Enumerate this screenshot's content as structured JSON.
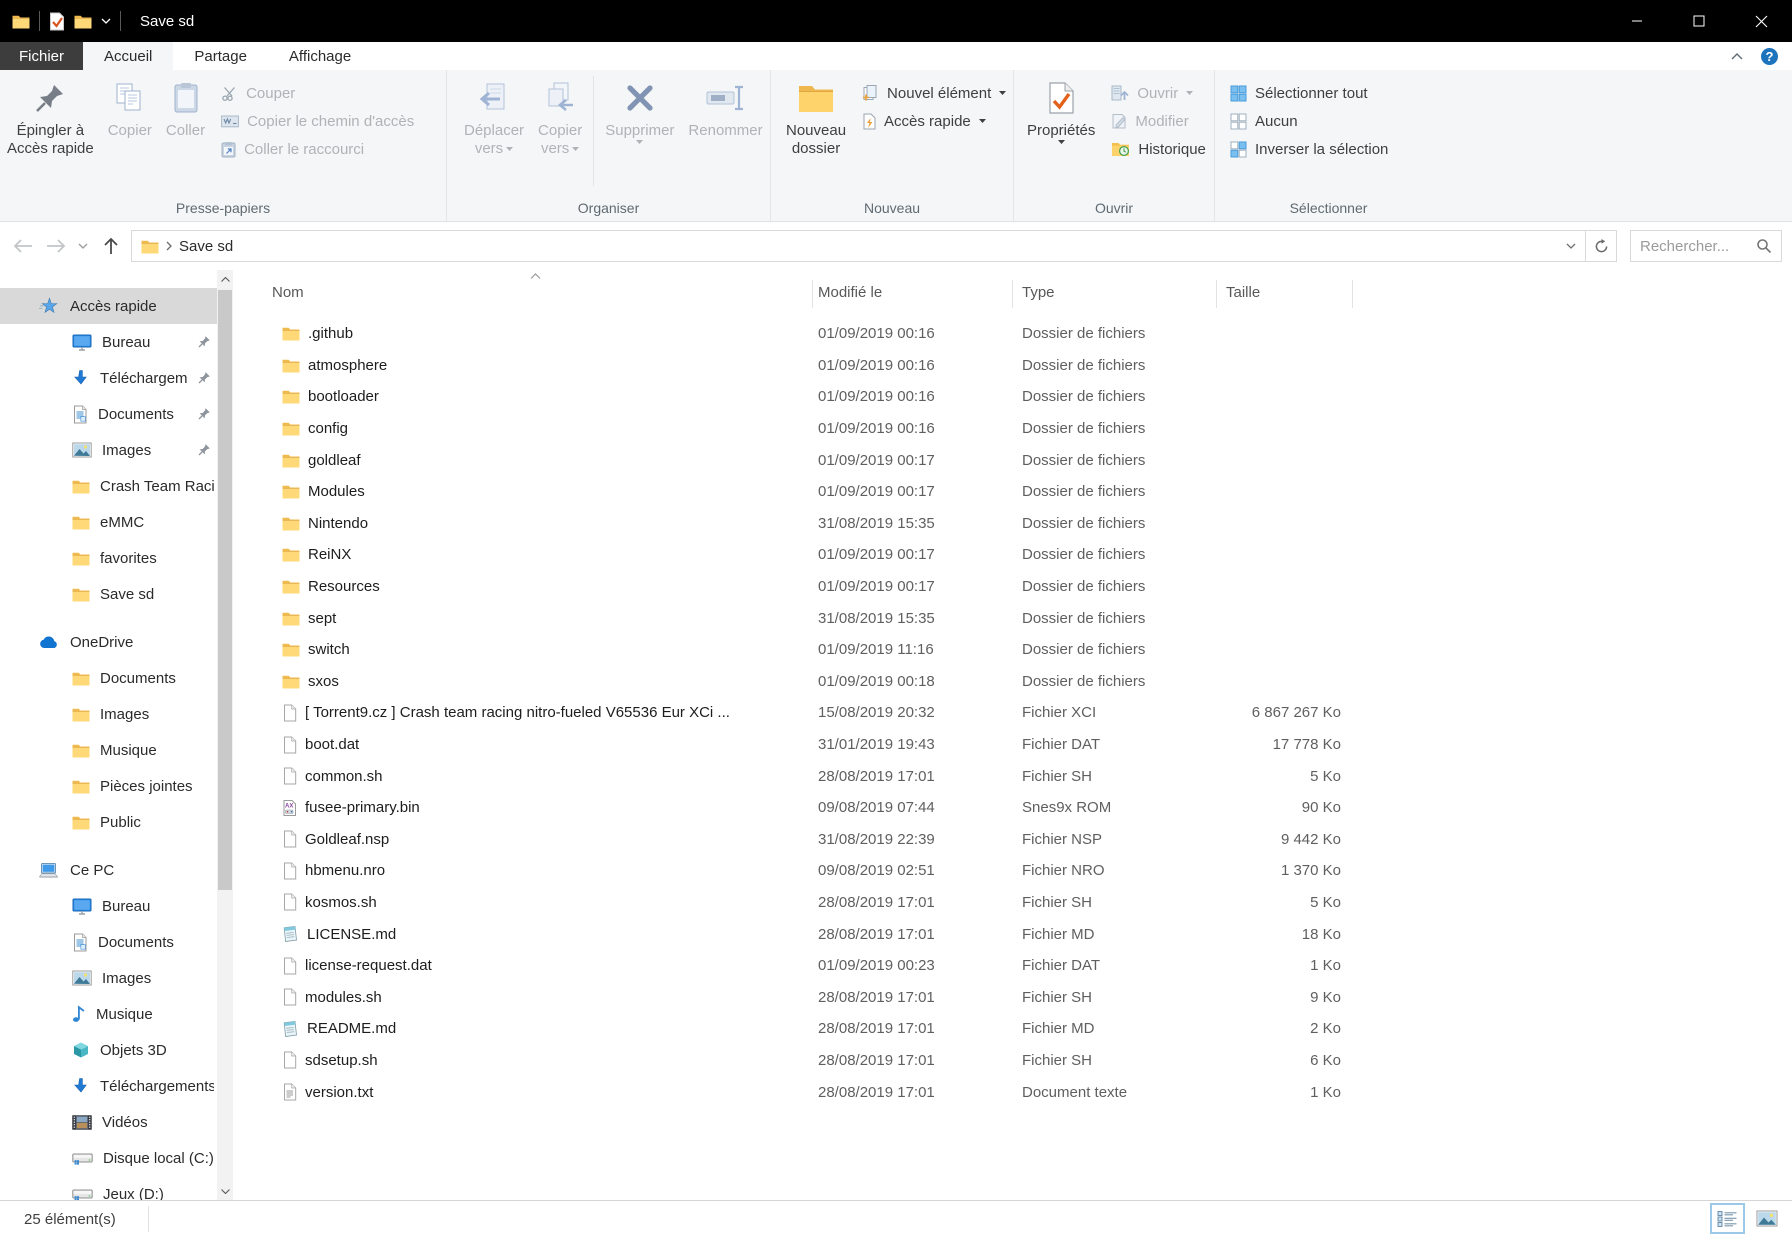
{
  "titlebar": {
    "title": "Save sd"
  },
  "tabs": {
    "file": "Fichier",
    "home": "Accueil",
    "share": "Partage",
    "view": "Affichage"
  },
  "ribbon": {
    "clipboard": {
      "group_label": "Presse-papiers",
      "pin_line1": "Épingler à",
      "pin_line2": "Accès rapide",
      "copy": "Copier",
      "paste": "Coller",
      "cut": "Couper",
      "copy_path": "Copier le chemin d'accès",
      "paste_shortcut": "Coller le raccourci"
    },
    "organize": {
      "group_label": "Organiser",
      "move_line1": "Déplacer",
      "move_line2": "vers",
      "copyto_line1": "Copier",
      "copyto_line2": "vers",
      "delete": "Supprimer",
      "rename": "Renommer"
    },
    "new": {
      "group_label": "Nouveau",
      "new_folder_line1": "Nouveau",
      "new_folder_line2": "dossier",
      "new_item": "Nouvel élément",
      "easy_access": "Accès rapide"
    },
    "open": {
      "group_label": "Ouvrir",
      "properties": "Propriétés",
      "open": "Ouvrir",
      "edit": "Modifier",
      "history": "Historique"
    },
    "select": {
      "group_label": "Sélectionner",
      "select_all": "Sélectionner tout",
      "select_none": "Aucun",
      "invert": "Inverser la sélection"
    }
  },
  "addressbar": {
    "breadcrumb": "Save sd",
    "search_placeholder": "Rechercher..."
  },
  "sidebar": {
    "sections": [
      {
        "label": "Accès rapide",
        "icon": "quick-access-icon",
        "selected": true,
        "items": [
          {
            "label": "Bureau",
            "icon": "desktop-icon",
            "pinned": true
          },
          {
            "label": "Téléchargements",
            "icon": "download-icon",
            "pinned": true
          },
          {
            "label": "Documents",
            "icon": "document-icon",
            "pinned": true
          },
          {
            "label": "Images",
            "icon": "picture-icon",
            "pinned": true
          },
          {
            "label": "Crash Team Racing",
            "icon": "folder-icon",
            "pinned": false
          },
          {
            "label": "eMMC",
            "icon": "folder-icon",
            "pinned": false
          },
          {
            "label": "favorites",
            "icon": "folder-icon",
            "pinned": false
          },
          {
            "label": "Save sd",
            "icon": "folder-icon",
            "pinned": false
          }
        ]
      },
      {
        "label": "OneDrive",
        "icon": "onedrive-icon",
        "selected": false,
        "items": [
          {
            "label": "Documents",
            "icon": "folder-icon",
            "pinned": false
          },
          {
            "label": "Images",
            "icon": "folder-icon",
            "pinned": false
          },
          {
            "label": "Musique",
            "icon": "folder-icon",
            "pinned": false
          },
          {
            "label": "Pièces jointes",
            "icon": "folder-icon",
            "pinned": false
          },
          {
            "label": "Public",
            "icon": "folder-icon",
            "pinned": false
          }
        ]
      },
      {
        "label": "Ce PC",
        "icon": "computer-icon",
        "selected": false,
        "items": [
          {
            "label": "Bureau",
            "icon": "desktop-icon",
            "pinned": false
          },
          {
            "label": "Documents",
            "icon": "document-icon",
            "pinned": false
          },
          {
            "label": "Images",
            "icon": "picture-icon",
            "pinned": false
          },
          {
            "label": "Musique",
            "icon": "music-icon",
            "pinned": false
          },
          {
            "label": "Objets 3D",
            "icon": "cube-icon",
            "pinned": false
          },
          {
            "label": "Téléchargements",
            "icon": "download-icon",
            "pinned": false
          },
          {
            "label": "Vidéos",
            "icon": "video-icon",
            "pinned": false
          },
          {
            "label": "Disque local (C:)",
            "icon": "drive-icon",
            "pinned": false
          },
          {
            "label": "Jeux (D:)",
            "icon": "drive-icon",
            "pinned": false
          }
        ]
      }
    ]
  },
  "filelist": {
    "columns": {
      "name": "Nom",
      "date": "Modifié le",
      "type": "Type",
      "size": "Taille"
    },
    "rows": [
      {
        "name": ".github",
        "icon": "folder-icon",
        "date": "01/09/2019 00:16",
        "type": "Dossier de fichiers",
        "size": ""
      },
      {
        "name": "atmosphere",
        "icon": "folder-icon",
        "date": "01/09/2019 00:16",
        "type": "Dossier de fichiers",
        "size": ""
      },
      {
        "name": "bootloader",
        "icon": "folder-icon",
        "date": "01/09/2019 00:16",
        "type": "Dossier de fichiers",
        "size": ""
      },
      {
        "name": "config",
        "icon": "folder-icon",
        "date": "01/09/2019 00:16",
        "type": "Dossier de fichiers",
        "size": ""
      },
      {
        "name": "goldleaf",
        "icon": "folder-icon",
        "date": "01/09/2019 00:17",
        "type": "Dossier de fichiers",
        "size": ""
      },
      {
        "name": "Modules",
        "icon": "folder-icon",
        "date": "01/09/2019 00:17",
        "type": "Dossier de fichiers",
        "size": ""
      },
      {
        "name": "Nintendo",
        "icon": "folder-icon",
        "date": "31/08/2019 15:35",
        "type": "Dossier de fichiers",
        "size": ""
      },
      {
        "name": "ReiNX",
        "icon": "folder-icon",
        "date": "01/09/2019 00:17",
        "type": "Dossier de fichiers",
        "size": ""
      },
      {
        "name": "Resources",
        "icon": "folder-icon",
        "date": "01/09/2019 00:17",
        "type": "Dossier de fichiers",
        "size": ""
      },
      {
        "name": "sept",
        "icon": "folder-icon",
        "date": "31/08/2019 15:35",
        "type": "Dossier de fichiers",
        "size": ""
      },
      {
        "name": "switch",
        "icon": "folder-icon",
        "date": "01/09/2019 11:16",
        "type": "Dossier de fichiers",
        "size": ""
      },
      {
        "name": "sxos",
        "icon": "folder-icon",
        "date": "01/09/2019 00:18",
        "type": "Dossier de fichiers",
        "size": ""
      },
      {
        "name": "[ Torrent9.cz ] Crash team racing nitro-fueled V65536 Eur XCi ...",
        "icon": "file-icon",
        "date": "15/08/2019 20:32",
        "type": "Fichier XCI",
        "size": "6 867 267 Ko"
      },
      {
        "name": "boot.dat",
        "icon": "file-icon",
        "date": "31/01/2019 19:43",
        "type": "Fichier DAT",
        "size": "17 778 Ko"
      },
      {
        "name": "common.sh",
        "icon": "file-icon",
        "date": "28/08/2019 17:01",
        "type": "Fichier SH",
        "size": "5 Ko"
      },
      {
        "name": "fusee-primary.bin",
        "icon": "rom-icon",
        "date": "09/08/2019 07:44",
        "type": "Snes9x ROM",
        "size": "90 Ko"
      },
      {
        "name": "Goldleaf.nsp",
        "icon": "file-icon",
        "date": "31/08/2019 22:39",
        "type": "Fichier NSP",
        "size": "9 442 Ko"
      },
      {
        "name": "hbmenu.nro",
        "icon": "file-icon",
        "date": "09/08/2019 02:51",
        "type": "Fichier NRO",
        "size": "1 370 Ko"
      },
      {
        "name": "kosmos.sh",
        "icon": "file-icon",
        "date": "28/08/2019 17:01",
        "type": "Fichier SH",
        "size": "5 Ko"
      },
      {
        "name": "LICENSE.md",
        "icon": "notepad-icon",
        "date": "28/08/2019 17:01",
        "type": "Fichier MD",
        "size": "18 Ko"
      },
      {
        "name": "license-request.dat",
        "icon": "file-icon",
        "date": "01/09/2019 00:23",
        "type": "Fichier DAT",
        "size": "1 Ko"
      },
      {
        "name": "modules.sh",
        "icon": "file-icon",
        "date": "28/08/2019 17:01",
        "type": "Fichier SH",
        "size": "9 Ko"
      },
      {
        "name": "README.md",
        "icon": "notepad-icon",
        "date": "28/08/2019 17:01",
        "type": "Fichier MD",
        "size": "2 Ko"
      },
      {
        "name": "sdsetup.sh",
        "icon": "file-icon",
        "date": "28/08/2019 17:01",
        "type": "Fichier SH",
        "size": "6 Ko"
      },
      {
        "name": "version.txt",
        "icon": "text-icon",
        "date": "28/08/2019 17:01",
        "type": "Document texte",
        "size": "1 Ko"
      }
    ]
  },
  "statusbar": {
    "items_count": "25 élément(s)"
  },
  "colors": {
    "titlebar": "#000000",
    "ribbon_bg": "#f5f6f7",
    "accent_folder": "#ffd36b",
    "selected_sidebar": "#d9d9d9",
    "disabled_text": "#b0b3b6"
  }
}
